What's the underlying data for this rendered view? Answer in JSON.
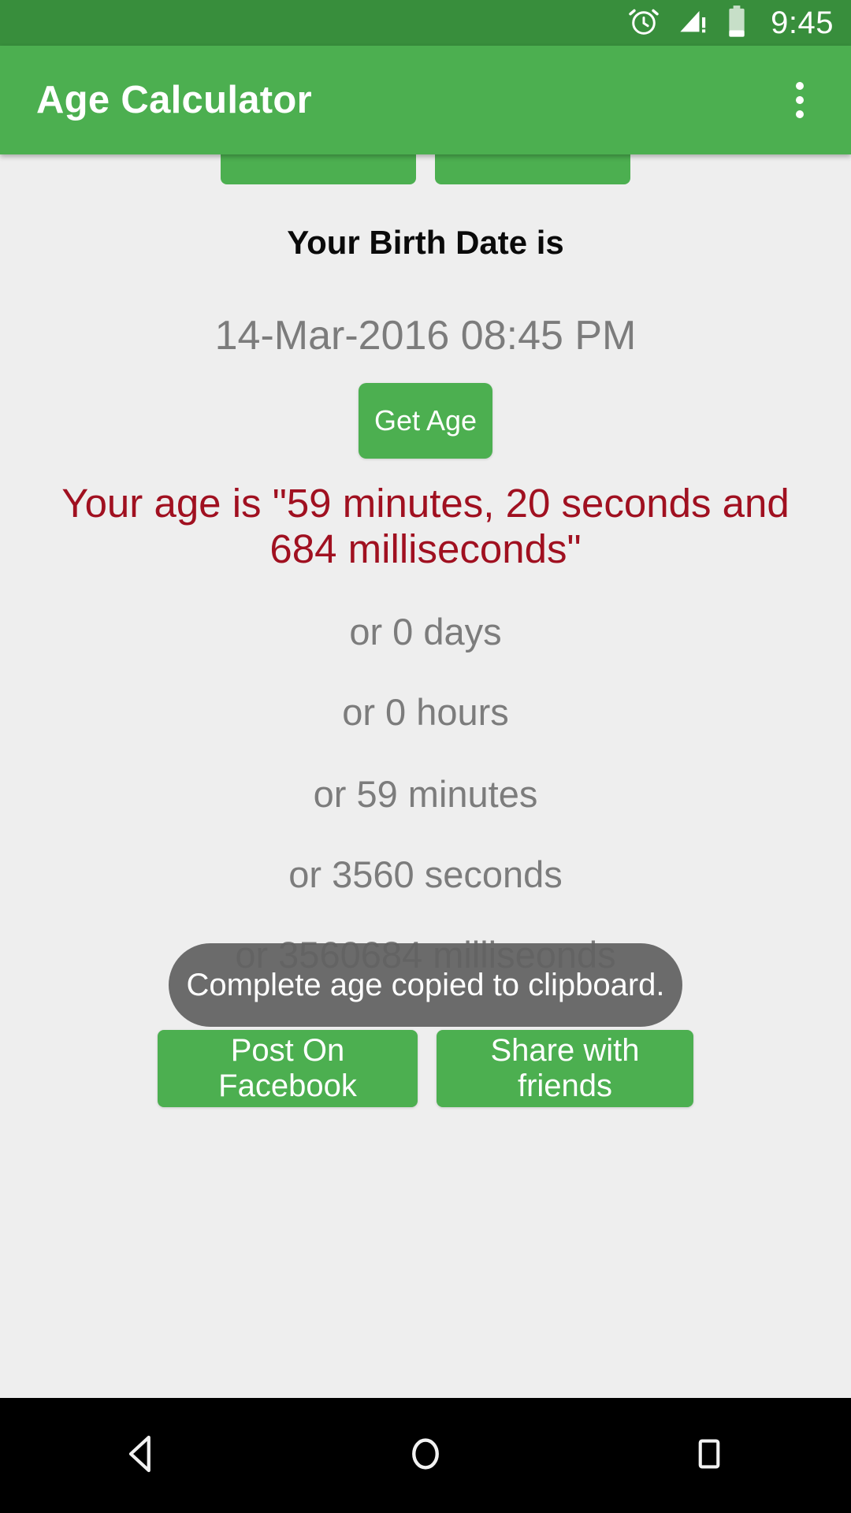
{
  "status_bar": {
    "time": "9:45",
    "icons": [
      "alarm-icon",
      "signal-warning-icon",
      "battery-icon"
    ],
    "background_color": "#388E3C"
  },
  "app_bar": {
    "title": "Age Calculator",
    "overflow_label": "More options",
    "background_color": "#4CAF50"
  },
  "main": {
    "background_color": "#eeeeee",
    "top_buttons": [
      {
        "label": ""
      },
      {
        "label": ""
      }
    ],
    "birthdate_heading": "Your Birth Date is",
    "birthdate_value": "14-Mar-2016 08:45 PM",
    "get_age_label": "Get Age",
    "age_result": "Your age is \"59 minutes, 20 seconds and 684 milliseconds\"",
    "age_result_color": "#A01020",
    "alternate_units": [
      "or 0 days",
      "or 0 hours",
      "or 59 minutes",
      "or 3560 seconds",
      "or 3560684 milliseonds"
    ]
  },
  "toast": {
    "message": "Complete age copied to clipboard.",
    "background_color": "#616161"
  },
  "share": {
    "facebook_label": "Post On Facebook",
    "friends_label": "Share with friends"
  },
  "nav_bar": {
    "background_color": "#000000",
    "buttons": [
      {
        "name": "back-icon",
        "label": "Back"
      },
      {
        "name": "home-icon",
        "label": "Home"
      },
      {
        "name": "recents-icon",
        "label": "Recents"
      }
    ]
  }
}
